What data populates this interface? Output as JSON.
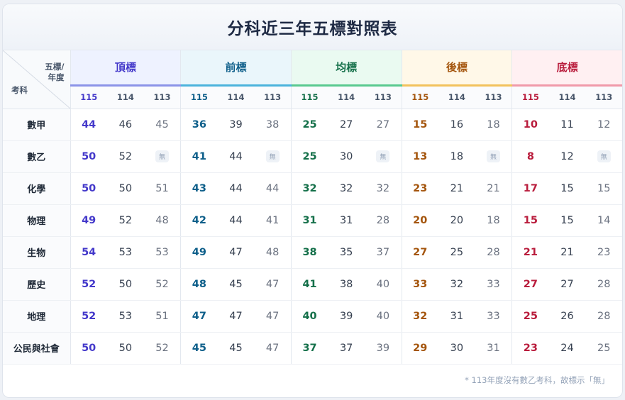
{
  "title": "分科近三年五標對照表",
  "corner": {
    "top_line1": "五標/",
    "top_line2": "年度",
    "bottom": "考科"
  },
  "years": [
    "115",
    "114",
    "113"
  ],
  "groups": [
    {
      "name": "頂標",
      "color": "#4338ca",
      "bg": "#eef2ff",
      "border": "#8b93e8"
    },
    {
      "name": "前標",
      "color": "#0e5f8a",
      "bg": "#eaf6fb",
      "border": "#4bb3dc"
    },
    {
      "name": "均標",
      "color": "#15704a",
      "bg": "#eafaf1",
      "border": "#59c98f"
    },
    {
      "name": "後標",
      "color": "#a4550d",
      "bg": "#fff8e8",
      "border": "#f2c25c"
    },
    {
      "name": "底標",
      "color": "#b91c3c",
      "bg": "#fff0f2",
      "border": "#f09aaa"
    }
  ],
  "missing_label": "無",
  "rows": [
    {
      "subject": "數甲",
      "values": [
        [
          "44",
          "46",
          "45"
        ],
        [
          "36",
          "39",
          "38"
        ],
        [
          "25",
          "27",
          "27"
        ],
        [
          "15",
          "16",
          "18"
        ],
        [
          "10",
          "11",
          "12"
        ]
      ]
    },
    {
      "subject": "數乙",
      "values": [
        [
          "50",
          "52",
          null
        ],
        [
          "41",
          "44",
          null
        ],
        [
          "25",
          "30",
          null
        ],
        [
          "13",
          "18",
          null
        ],
        [
          "8",
          "12",
          null
        ]
      ]
    },
    {
      "subject": "化學",
      "values": [
        [
          "50",
          "50",
          "51"
        ],
        [
          "43",
          "44",
          "44"
        ],
        [
          "32",
          "32",
          "32"
        ],
        [
          "23",
          "21",
          "21"
        ],
        [
          "17",
          "15",
          "15"
        ]
      ]
    },
    {
      "subject": "物理",
      "values": [
        [
          "49",
          "52",
          "48"
        ],
        [
          "42",
          "44",
          "41"
        ],
        [
          "31",
          "31",
          "28"
        ],
        [
          "20",
          "20",
          "18"
        ],
        [
          "15",
          "15",
          "14"
        ]
      ]
    },
    {
      "subject": "生物",
      "values": [
        [
          "54",
          "53",
          "53"
        ],
        [
          "49",
          "47",
          "48"
        ],
        [
          "38",
          "35",
          "37"
        ],
        [
          "27",
          "25",
          "28"
        ],
        [
          "21",
          "21",
          "23"
        ]
      ]
    },
    {
      "subject": "歷史",
      "values": [
        [
          "52",
          "50",
          "52"
        ],
        [
          "48",
          "45",
          "47"
        ],
        [
          "41",
          "38",
          "40"
        ],
        [
          "33",
          "32",
          "33"
        ],
        [
          "27",
          "27",
          "28"
        ]
      ]
    },
    {
      "subject": "地理",
      "values": [
        [
          "52",
          "53",
          "51"
        ],
        [
          "47",
          "47",
          "47"
        ],
        [
          "40",
          "39",
          "40"
        ],
        [
          "32",
          "31",
          "33"
        ],
        [
          "25",
          "26",
          "28"
        ]
      ]
    },
    {
      "subject": "公民與社會",
      "values": [
        [
          "50",
          "50",
          "52"
        ],
        [
          "45",
          "45",
          "47"
        ],
        [
          "37",
          "37",
          "39"
        ],
        [
          "29",
          "30",
          "31"
        ],
        [
          "23",
          "24",
          "25"
        ]
      ]
    }
  ],
  "footer_note": "* 113年度沒有數乙考科，故標示「無」"
}
